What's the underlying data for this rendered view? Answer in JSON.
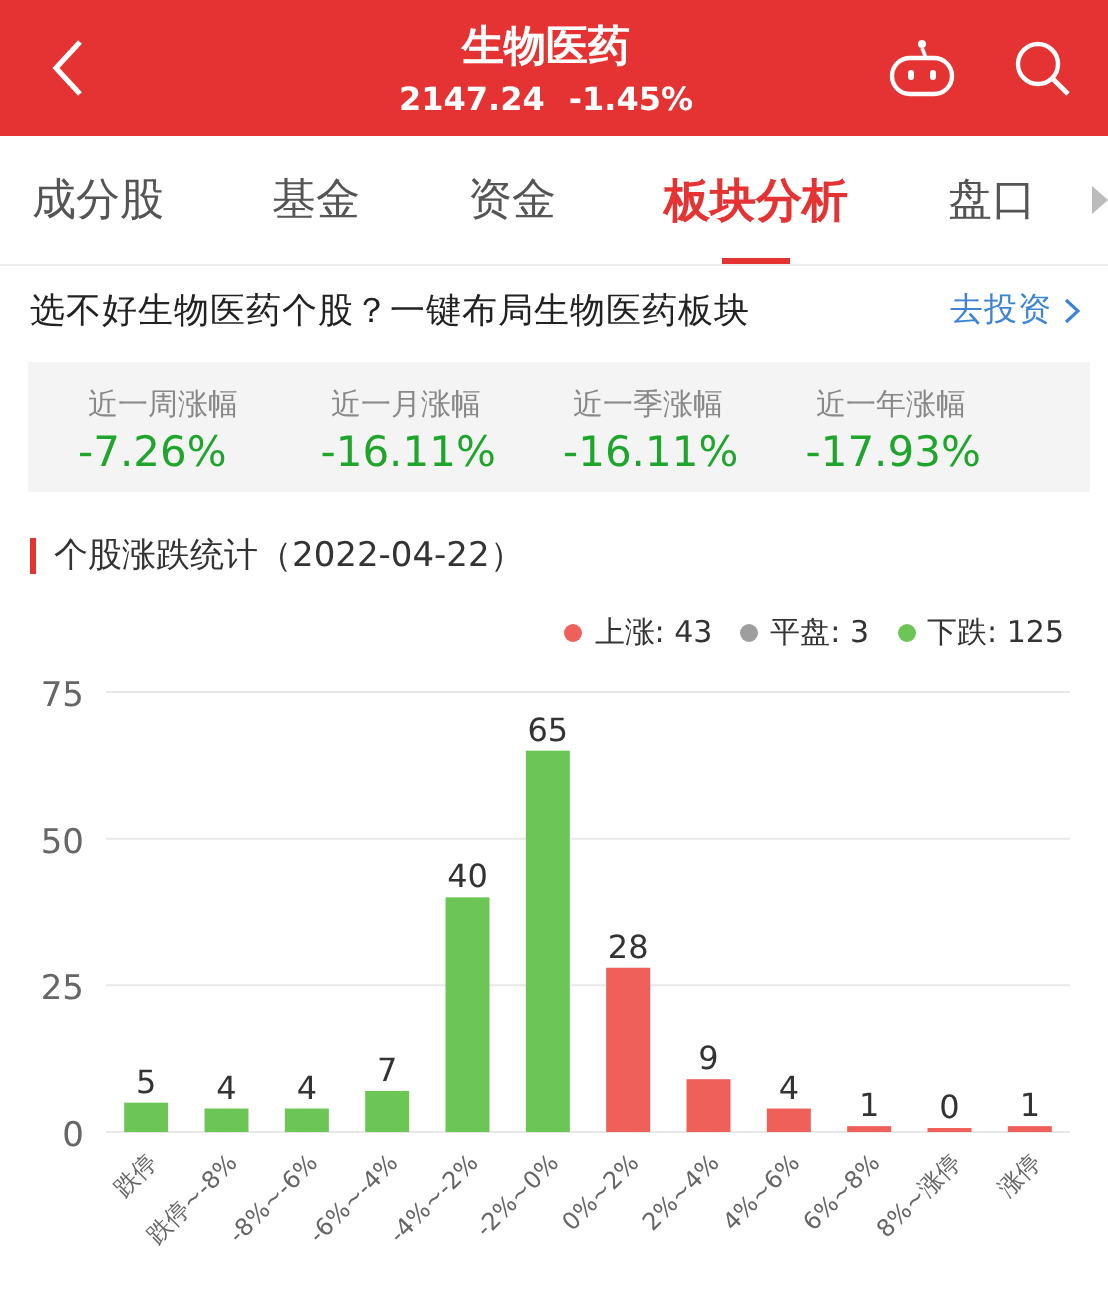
{
  "header": {
    "title": "生物医药",
    "price": "2147.24",
    "change": "-1.45%"
  },
  "tabs": [
    {
      "label": "成分股",
      "selected": false
    },
    {
      "label": "基金",
      "selected": false
    },
    {
      "label": "资金",
      "selected": false
    },
    {
      "label": "板块分析",
      "selected": true
    },
    {
      "label": "盘口",
      "selected": false
    }
  ],
  "promo": {
    "text": "选不好生物医药个股？一键布局生物医药板块",
    "link": "去投资"
  },
  "stats": [
    {
      "label": "近一周涨幅",
      "value": "-7.26%"
    },
    {
      "label": "近一月涨幅",
      "value": "-16.11%"
    },
    {
      "label": "近一季涨幅",
      "value": "-16.11%"
    },
    {
      "label": "近一年涨幅",
      "value": "-17.93%"
    }
  ],
  "section_title": "个股涨跌统计（2022-04-22）",
  "legend": [
    {
      "label": "上涨: 43",
      "color": "#f0605a"
    },
    {
      "label": "平盘: 3",
      "color": "#9e9e9e"
    },
    {
      "label": "下跌: 125",
      "color": "#6cc655"
    }
  ],
  "chart_data": {
    "type": "bar",
    "data_labels": true,
    "categories": [
      "跌停",
      "跌停~-8%",
      "-8%~-6%",
      "-6%~-4%",
      "-4%~-2%",
      "-2%~0%",
      "0%~2%",
      "2%~4%",
      "4%~6%",
      "6%~8%",
      "8%~涨停",
      "涨停"
    ],
    "series": [
      {
        "color": "#6cc655",
        "values": [
          5,
          4,
          4,
          7,
          40,
          65,
          null,
          null,
          null,
          null,
          null,
          null
        ]
      },
      {
        "color": "#f0605a",
        "values": [
          null,
          null,
          null,
          null,
          null,
          null,
          28,
          9,
          4,
          1,
          0,
          1
        ]
      }
    ],
    "ylim": [
      0,
      75
    ],
    "yticks": [
      0,
      25,
      50,
      75
    ]
  }
}
